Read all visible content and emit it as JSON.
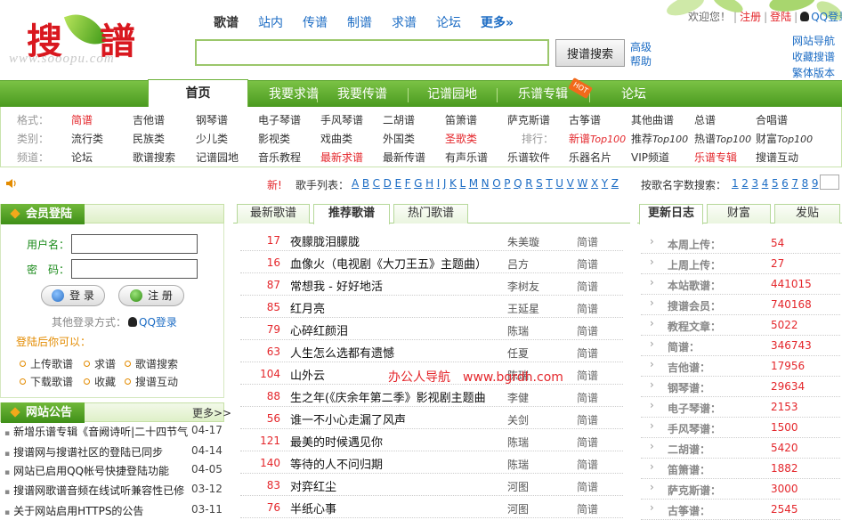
{
  "logo": {
    "chars": [
      "搜",
      "譜"
    ],
    "url": "www.sooopu.com"
  },
  "top_nav": [
    {
      "label": "歌谱",
      "active": true
    },
    {
      "label": "站内"
    },
    {
      "label": "传谱"
    },
    {
      "label": "制谱"
    },
    {
      "label": "求谱"
    },
    {
      "label": "论坛"
    },
    {
      "label": "更多»",
      "more": true
    }
  ],
  "search": {
    "value": "",
    "button": "搜谱搜索",
    "links": [
      "高级",
      "帮助"
    ]
  },
  "user_bar": {
    "greeting": "欢迎您！",
    "register": "注册",
    "login": "登陆",
    "qq_login": "QQ登录"
  },
  "right_links": [
    "网站导航",
    "收藏搜谱",
    "繁体版本"
  ],
  "main_nav": [
    {
      "label": "首页",
      "active": true
    },
    {
      "label": "我要求谱"
    },
    {
      "label": "我要传谱"
    },
    {
      "label": "记谱园地"
    },
    {
      "label": "乐谱专辑",
      "badge": "HOT"
    },
    {
      "label": "论坛"
    }
  ],
  "category_grid": {
    "rows": [
      {
        "label": "格式：",
        "items": [
          {
            "text": "简谱",
            "red": true
          },
          {
            "text": "吉他谱"
          },
          {
            "text": "钢琴谱"
          },
          {
            "text": "电子琴谱"
          },
          {
            "text": "手风琴谱"
          },
          {
            "text": "二胡谱"
          },
          {
            "text": "笛箫谱"
          },
          {
            "text": "萨克斯谱"
          },
          {
            "text": "古筝谱"
          },
          {
            "text": "其他曲谱"
          },
          {
            "text": "总谱"
          },
          {
            "text": "合唱谱"
          }
        ]
      },
      {
        "label": "类别：",
        "items": [
          {
            "text": "流行类"
          },
          {
            "text": "民族类"
          },
          {
            "text": "少儿类"
          },
          {
            "text": "影视类"
          },
          {
            "text": "戏曲类"
          },
          {
            "text": "外国类"
          },
          {
            "text": "圣歌类",
            "red": true
          },
          {
            "text": "排行：",
            "muted": true
          },
          {
            "text": "新谱",
            "suffix": "Top100",
            "red": true
          },
          {
            "text": "推荐",
            "suffix": "Top100"
          },
          {
            "text": "热谱",
            "suffix": "Top100"
          },
          {
            "text": "财富",
            "suffix": "Top100"
          }
        ]
      },
      {
        "label": "频道：",
        "items": [
          {
            "text": "论坛"
          },
          {
            "text": "歌谱搜索"
          },
          {
            "text": "记谱园地"
          },
          {
            "text": "音乐教程"
          },
          {
            "text": "最新求谱",
            "red": true
          },
          {
            "text": "最新传谱"
          },
          {
            "text": "有声乐谱"
          },
          {
            "text": "乐谱软件"
          },
          {
            "text": "乐器名片"
          },
          {
            "text": "VIP频道"
          },
          {
            "text": "乐谱专辑",
            "red": true
          },
          {
            "text": "搜谱互动"
          }
        ]
      }
    ]
  },
  "letter_bar": {
    "new": "新!",
    "label": "歌手列表：",
    "letters": [
      "A",
      "B",
      "C",
      "D",
      "E",
      "F",
      "G",
      "H",
      "I",
      "J",
      "K",
      "L",
      "M",
      "N",
      "O",
      "P",
      "Q",
      "R",
      "S",
      "T",
      "U",
      "V",
      "W",
      "X",
      "Y",
      "Z"
    ],
    "by_count_label": "按歌名字数搜索：",
    "numbers": [
      "1",
      "2",
      "3",
      "4",
      "5",
      "6",
      "7",
      "8",
      "9"
    ]
  },
  "login": {
    "title": "会员登陆",
    "username_label": "用户名：",
    "password_label": "密　码：",
    "login_button": "登 录",
    "register_button": "注 册",
    "other_login": "其他登录方式：",
    "qq_login": "QQ登录",
    "after_login": "登陆后你可以：",
    "features": [
      "上传歌谱",
      "求谱",
      "歌谱搜索",
      "下载歌谱",
      "收藏",
      "搜谱互动"
    ]
  },
  "notices": {
    "title": "网站公告",
    "more": "更多>>",
    "items": [
      {
        "text": "新增乐谱专辑《音阙诗听|二十四节气",
        "date": "04-17"
      },
      {
        "text": "搜谱网与搜谱社区的登陆已同步",
        "date": "04-14"
      },
      {
        "text": "网站已启用QQ帐号快捷登陆功能",
        "date": "04-05"
      },
      {
        "text": "搜谱网歌谱音频在线试听兼容性已修",
        "date": "03-12"
      },
      {
        "text": "关于网站启用HTTPS的公告",
        "date": "03-11"
      }
    ]
  },
  "song_tabs": [
    {
      "label": "最新歌谱"
    },
    {
      "label": "推荐歌谱",
      "active": true
    },
    {
      "label": "热门歌谱"
    }
  ],
  "songs": [
    {
      "num": "17",
      "title": "夜朦胧泪朦胧",
      "artist": "朱美璇",
      "type": "简谱"
    },
    {
      "num": "16",
      "title": "血像火（电视剧《大刀王五》主题曲）",
      "artist": "吕方",
      "type": "简谱"
    },
    {
      "num": "87",
      "title": "常想我 - 好好地活",
      "artist": "李树友",
      "type": "简谱"
    },
    {
      "num": "85",
      "title": "红月亮",
      "artist": "王延星",
      "type": "简谱"
    },
    {
      "num": "79",
      "title": "心碎红颜泪",
      "artist": "陈瑞",
      "type": "简谱"
    },
    {
      "num": "63",
      "title": "人生怎么选都有遗憾",
      "artist": "任夏",
      "type": "简谱"
    },
    {
      "num": "104",
      "title": "山外云",
      "artist": "陈瑞",
      "type": "简谱"
    },
    {
      "num": "88",
      "title": "生之年(《庆余年第二季》影视剧主题曲",
      "artist": "李健",
      "type": "简谱"
    },
    {
      "num": "56",
      "title": "谁一不小心走漏了风声",
      "artist": "关剑",
      "type": "简谱"
    },
    {
      "num": "121",
      "title": "最美的时候遇见你",
      "artist": "陈瑞",
      "type": "简谱"
    },
    {
      "num": "140",
      "title": "等待的人不问归期",
      "artist": "陈瑞",
      "type": "简谱"
    },
    {
      "num": "83",
      "title": "对弈红尘",
      "artist": "河图",
      "type": "简谱"
    },
    {
      "num": "76",
      "title": "半纸心事",
      "artist": "河图",
      "type": "简谱"
    }
  ],
  "watermark": "办公人导航　www.bgrdh.com",
  "stat_tabs": [
    {
      "label": "更新日志",
      "active": true
    },
    {
      "label": "财富"
    },
    {
      "label": "发贴"
    }
  ],
  "stats": [
    {
      "label": "本周上传：",
      "value": "54"
    },
    {
      "label": "上周上传：",
      "value": "27"
    },
    {
      "label": "本站歌谱：",
      "value": "441015"
    },
    {
      "label": "搜谱会员：",
      "value": "740168"
    },
    {
      "label": "教程文章：",
      "value": "5022"
    },
    {
      "label": "简谱：",
      "value": "346743"
    },
    {
      "label": "吉他谱：",
      "value": "17956"
    },
    {
      "label": "钢琴谱：",
      "value": "29634"
    },
    {
      "label": "电子琴谱：",
      "value": "2153"
    },
    {
      "label": "手风琴谱：",
      "value": "1500"
    },
    {
      "label": "二胡谱：",
      "value": "5420"
    },
    {
      "label": "笛箫谱：",
      "value": "1882"
    },
    {
      "label": "萨克斯谱：",
      "value": "3000"
    },
    {
      "label": "古筝谱：",
      "value": "2545"
    }
  ],
  "colors": {
    "brand_green": "#5aa52a",
    "accent_red": "#e4262b",
    "link_blue": "#1c6cc4"
  }
}
